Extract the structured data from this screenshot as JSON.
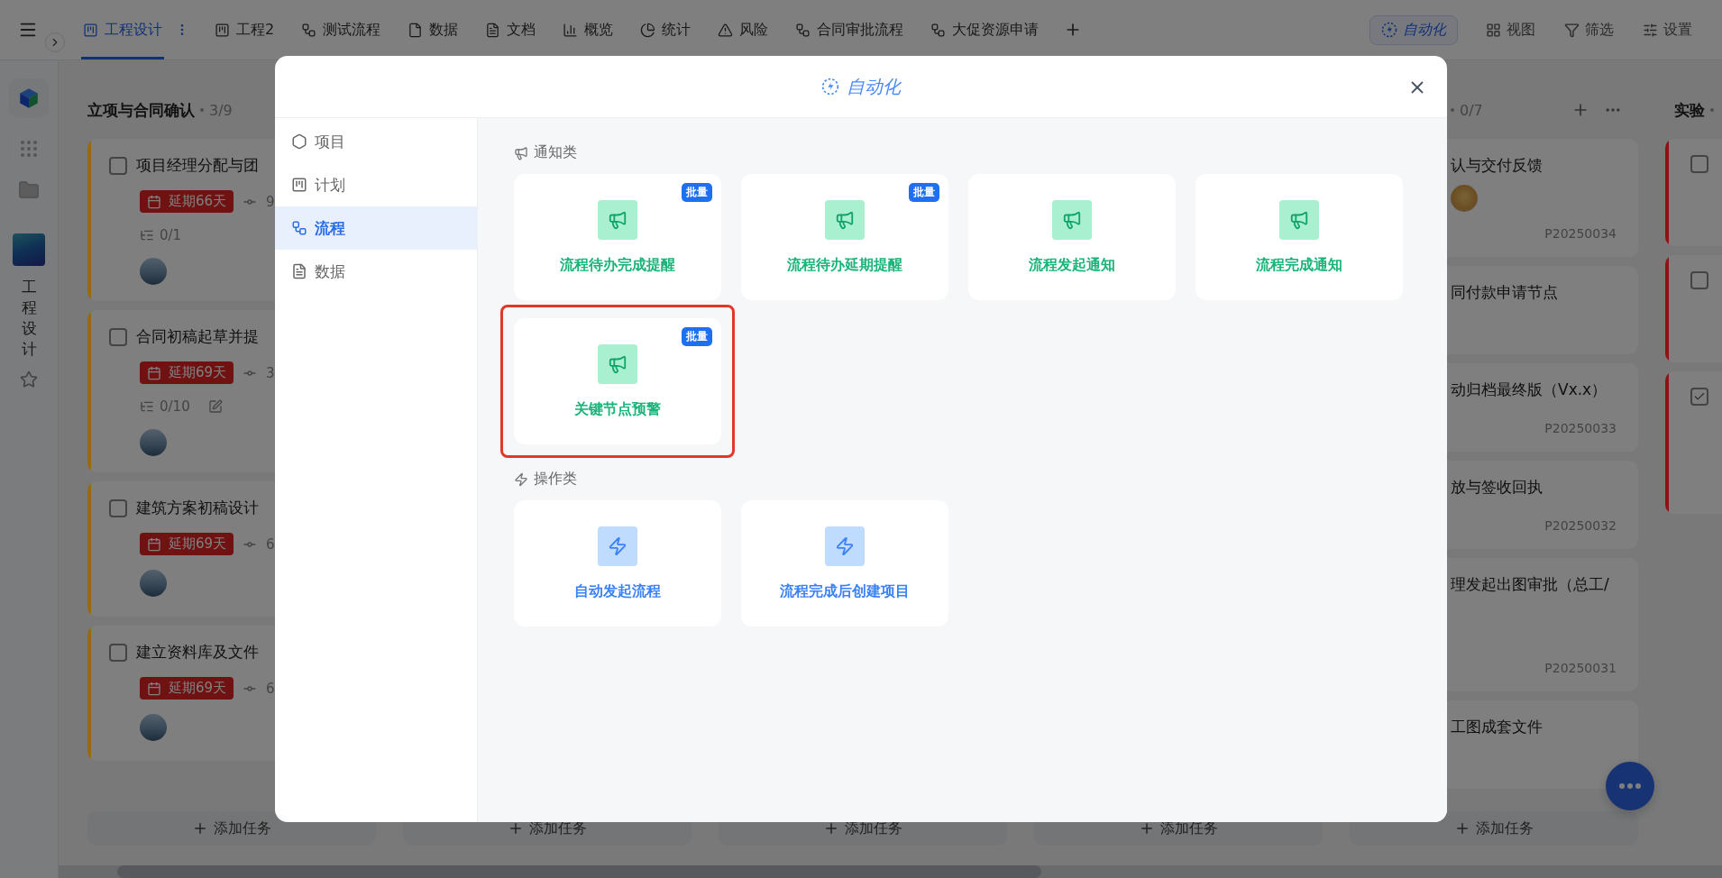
{
  "topbar": {
    "tabs": [
      {
        "label": "工程设计",
        "kind": "board",
        "selected": true
      },
      {
        "label": "工程2",
        "kind": "board",
        "selected": false
      },
      {
        "label": "测试流程",
        "kind": "flow",
        "selected": false
      },
      {
        "label": "数据",
        "kind": "doc",
        "selected": false
      },
      {
        "label": "文档",
        "kind": "text",
        "selected": false
      },
      {
        "label": "概览",
        "kind": "chart",
        "selected": false
      },
      {
        "label": "统计",
        "kind": "pie",
        "selected": false
      },
      {
        "label": "风险",
        "kind": "warning",
        "selected": false
      },
      {
        "label": "合同审批流程",
        "kind": "flow",
        "selected": false
      },
      {
        "label": "大促资源申请",
        "kind": "flow",
        "selected": false
      }
    ],
    "actions": [
      {
        "label": "自动化",
        "kind": "automation",
        "selected": true
      },
      {
        "label": "视图",
        "kind": "view",
        "selected": false
      },
      {
        "label": "筛选",
        "kind": "filter",
        "selected": false
      },
      {
        "label": "设置",
        "kind": "settings",
        "selected": false
      }
    ]
  },
  "rail": {
    "project_name": "工程设计"
  },
  "board": {
    "columns": [
      {
        "kind": "full",
        "title": "立项与合同确认",
        "count": "3/9",
        "add_label": "添加任务",
        "cards": [
          {
            "title": "项目经理分配与团",
            "checked": false,
            "color": "#9a6812",
            "overdue": "延期66天",
            "progress": "9",
            "subtasks": "0/1"
          },
          {
            "title": "合同初稿起草并提",
            "checked": false,
            "color": "#9a6812",
            "overdue": "延期69天",
            "progress": "3",
            "subtasks": "0/10",
            "editable": true
          },
          {
            "title": "建筑方案初稿设计",
            "checked": false,
            "color": "#9a6812",
            "overdue": "延期69天",
            "progress": "6"
          },
          {
            "title": "建立资料库及文件",
            "checked": false,
            "color": "#9a6812",
            "overdue": "延期69天",
            "progress": "6"
          }
        ]
      },
      {
        "kind": "covered",
        "add_label": "添加任务"
      },
      {
        "kind": "covered",
        "add_label": "添加任务"
      },
      {
        "kind": "covered",
        "add_label": "添加任务"
      },
      {
        "kind": "partly_covered",
        "count": "0/7",
        "add_label": "添加任务",
        "cards": [
          {
            "title": "认与交付反馈",
            "code": "P20250034",
            "avatar": true
          },
          {
            "title": "同付款申请节点"
          },
          {
            "title": "动归档最终版（Vx.x）",
            "code": "P20250033"
          },
          {
            "title": "放与签收回执",
            "code": "P20250032"
          },
          {
            "title": "理发起出图审批（总工/",
            "code": "P20250031"
          },
          {
            "title": "工图成套文件"
          }
        ]
      },
      {
        "kind": "cut",
        "title": "实验",
        "cards": [
          {
            "checked": false,
            "color": "#8c1414"
          },
          {
            "checked": false,
            "color": "#8c1414"
          },
          {
            "checked": true,
            "color": "#8c1414"
          }
        ]
      }
    ]
  },
  "modal": {
    "title": "自动化",
    "nav": [
      {
        "label": "项目",
        "kind": "project",
        "selected": false
      },
      {
        "label": "计划",
        "kind": "plan",
        "selected": false
      },
      {
        "label": "流程",
        "kind": "flow",
        "selected": true
      },
      {
        "label": "数据",
        "kind": "data",
        "selected": false
      }
    ],
    "sections": [
      {
        "label": "通知类",
        "kind": "notify",
        "cards": [
          {
            "label": "流程待办完成提醒",
            "badge": "批量",
            "highlighted": false
          },
          {
            "label": "流程待办延期提醒",
            "badge": "批量",
            "highlighted": false
          },
          {
            "label": "流程发起通知",
            "highlighted": false
          },
          {
            "label": "流程完成通知",
            "highlighted": false
          },
          {
            "label": "关键节点预警",
            "badge": "批量",
            "highlighted": true
          }
        ]
      },
      {
        "label": "操作类",
        "kind": "action",
        "cards": [
          {
            "label": "自动发起流程",
            "highlighted": false
          },
          {
            "label": "流程完成后创建项目",
            "highlighted": false
          }
        ]
      }
    ]
  }
}
